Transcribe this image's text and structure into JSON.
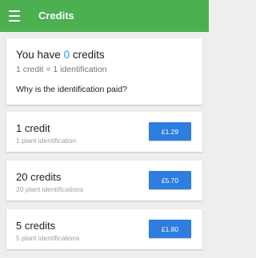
{
  "appbar": {
    "title": "Credits",
    "menu_icon": "hamburger-menu-icon"
  },
  "summary": {
    "prefix": "You have ",
    "count": "0",
    "suffix": " credits",
    "rate": "1 credit = 1 identification",
    "why_link": "Why is the identification paid?"
  },
  "offers": [
    {
      "title": "1 credit",
      "subtitle": "1 plant identification",
      "price": "£1.29"
    },
    {
      "title": "20 credits",
      "subtitle": "20 plant identifications",
      "price": "£5.70"
    },
    {
      "title": "5 credits",
      "subtitle": "5 plant identifications",
      "price": "£1.80"
    }
  ],
  "colors": {
    "appbar": "#4caf50",
    "accent_count": "#2196f3",
    "price_button": "#2e7de1",
    "background": "#eeeeee"
  }
}
